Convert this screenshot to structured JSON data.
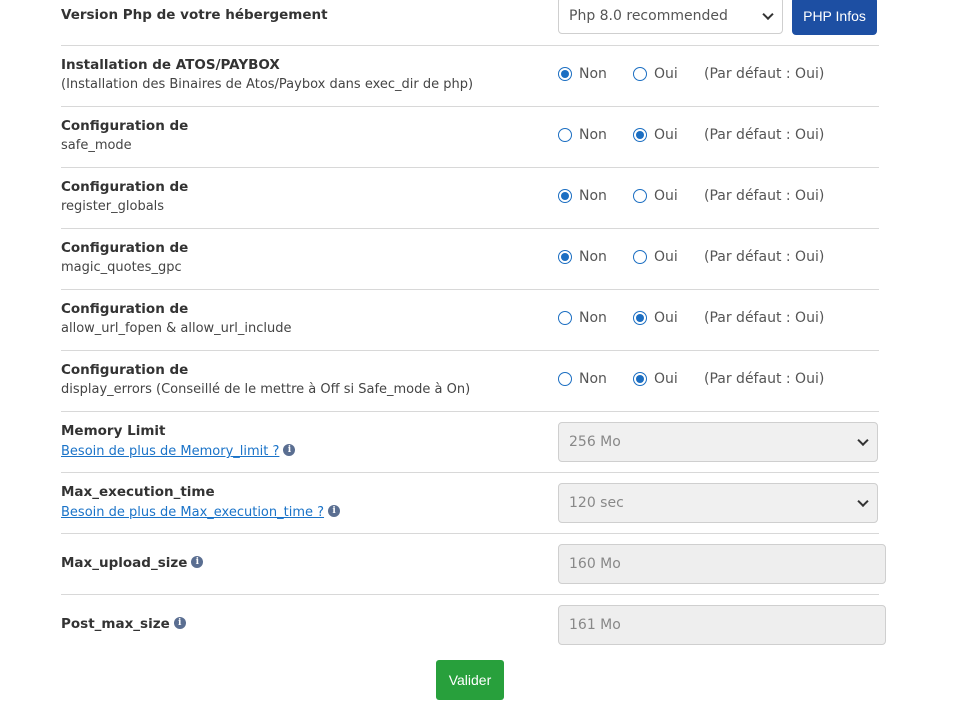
{
  "php_version": {
    "label": "Version Php de votre hébergement",
    "selected": "Php 8.0 recommended",
    "button": "PHP Infos"
  },
  "radio_rows": [
    {
      "title": "Installation de ATOS/PAYBOX",
      "sub": "(Installation des Binaires de Atos/Paybox dans exec_dir de php)",
      "non": "Non",
      "oui": "Oui",
      "default": "(Par défaut : Oui)",
      "selected": "non"
    },
    {
      "title": "Configuration de",
      "sub": "safe_mode",
      "non": "Non",
      "oui": "Oui",
      "default": "(Par défaut : Oui)",
      "selected": "oui"
    },
    {
      "title": "Configuration de",
      "sub": "register_globals",
      "non": "Non",
      "oui": "Oui",
      "default": "(Par défaut : Oui)",
      "selected": "non"
    },
    {
      "title": "Configuration de",
      "sub": "magic_quotes_gpc",
      "non": "Non",
      "oui": "Oui",
      "default": "(Par défaut : Oui)",
      "selected": "non"
    },
    {
      "title": "Configuration de",
      "sub": "allow_url_fopen & allow_url_include",
      "non": "Non",
      "oui": "Oui",
      "default": "(Par défaut : Oui)",
      "selected": "oui"
    },
    {
      "title": "Configuration de",
      "sub": "display_errors (Conseillé de le mettre à Off si Safe_mode à On)",
      "non": "Non",
      "oui": "Oui",
      "default": "(Par défaut : Oui)",
      "selected": "oui"
    }
  ],
  "memory_limit": {
    "title": "Memory Limit",
    "link": "Besoin de plus de Memory_limit ?",
    "selected": "256 Mo"
  },
  "max_execution_time": {
    "title": "Max_execution_time",
    "link": "Besoin de plus de Max_execution_time ?",
    "selected": "120 sec"
  },
  "max_upload_size": {
    "title": "Max_upload_size",
    "value": "160 Mo"
  },
  "post_max_size": {
    "title": "Post_max_size",
    "value": "161 Mo"
  },
  "info_glyph": "i",
  "submit_label": "Valider",
  "colors": {
    "primary": "#1d4fa3",
    "radio": "#1b6ec2",
    "link": "#1a73c8",
    "submit": "#28a03c"
  },
  "icons": {
    "info": "info-circle-icon",
    "select": "chevron-down-icon"
  }
}
